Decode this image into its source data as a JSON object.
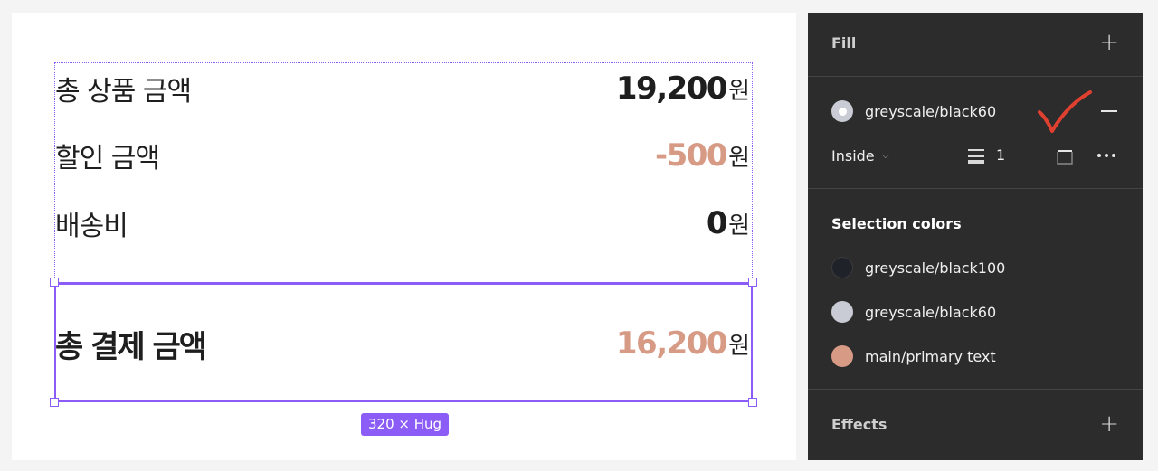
{
  "canvas": {
    "rows": [
      {
        "label": "총 상품 금액",
        "value": "19,200",
        "unit": "원"
      },
      {
        "label": "할인 금액",
        "value": "-500",
        "unit": "원"
      },
      {
        "label": "배송비",
        "value": "0",
        "unit": "원"
      }
    ],
    "total": {
      "label": "총 결제 금액",
      "value": "16,200",
      "unit": "원"
    },
    "size_badge": "320 × Hug",
    "colors": {
      "selection": "#8b5cf6",
      "accent": "#d79a84",
      "text": "#1e1e1e"
    }
  },
  "panel": {
    "fill": {
      "title": "Fill",
      "add_icon": "plus-icon",
      "stroke_color_name": "greyscale/black60",
      "remove_icon": "minus-icon",
      "position": "Inside",
      "weight": "1",
      "annotation_icon": "red-check-mark-icon"
    },
    "selection_colors": {
      "title": "Selection colors",
      "items": [
        {
          "name": "greyscale/black100",
          "color": "#1f2329"
        },
        {
          "name": "greyscale/black60",
          "color": "#c9ccd4"
        },
        {
          "name": "main/primary text",
          "color": "#d79a84"
        }
      ]
    },
    "effects": {
      "title": "Effects",
      "add_icon": "plus-icon"
    }
  }
}
